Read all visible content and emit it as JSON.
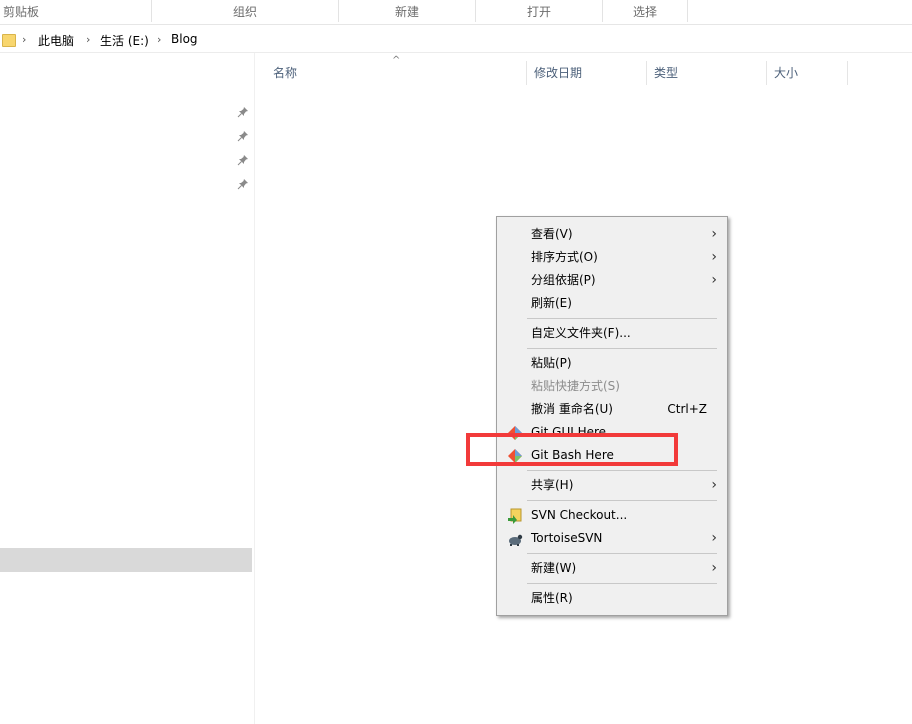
{
  "ribbon": {
    "groups": [
      "剪贴板",
      "组织",
      "新建",
      "打开",
      "选择"
    ]
  },
  "address": {
    "crumbs": [
      "此电脑",
      "生活 (E:)",
      "Blog"
    ]
  },
  "columns": [
    "名称",
    "修改日期",
    "类型",
    "大小"
  ],
  "context_menu": {
    "view": "查看(V)",
    "sort": "排序方式(O)",
    "group": "分组依据(P)",
    "refresh": "刷新(E)",
    "customize": "自定义文件夹(F)...",
    "paste": "粘贴(P)",
    "paste_shortcut": "粘贴快捷方式(S)",
    "undo_rename": "撤消 重命名(U)",
    "undo_shortcut": "Ctrl+Z",
    "git_gui": "Git GUI Here",
    "git_bash": "Git Bash Here",
    "share": "共享(H)",
    "svn_checkout": "SVN Checkout...",
    "tortoise_svn": "TortoiseSVN",
    "new": "新建(W)",
    "properties": "属性(R)"
  },
  "colors": {
    "highlight": "#f23a3a",
    "menu_bg": "#f0f0f0",
    "nav_selected": "#d9d9d9"
  },
  "icons": {
    "folder": "folder-icon",
    "pin": "pin-icon",
    "git": "git-icon",
    "svn_checkout": "svn-checkout-icon",
    "tortoise": "tortoise-svn-icon",
    "submenu": "chevron-right-icon",
    "sort": "sort-up-icon"
  }
}
